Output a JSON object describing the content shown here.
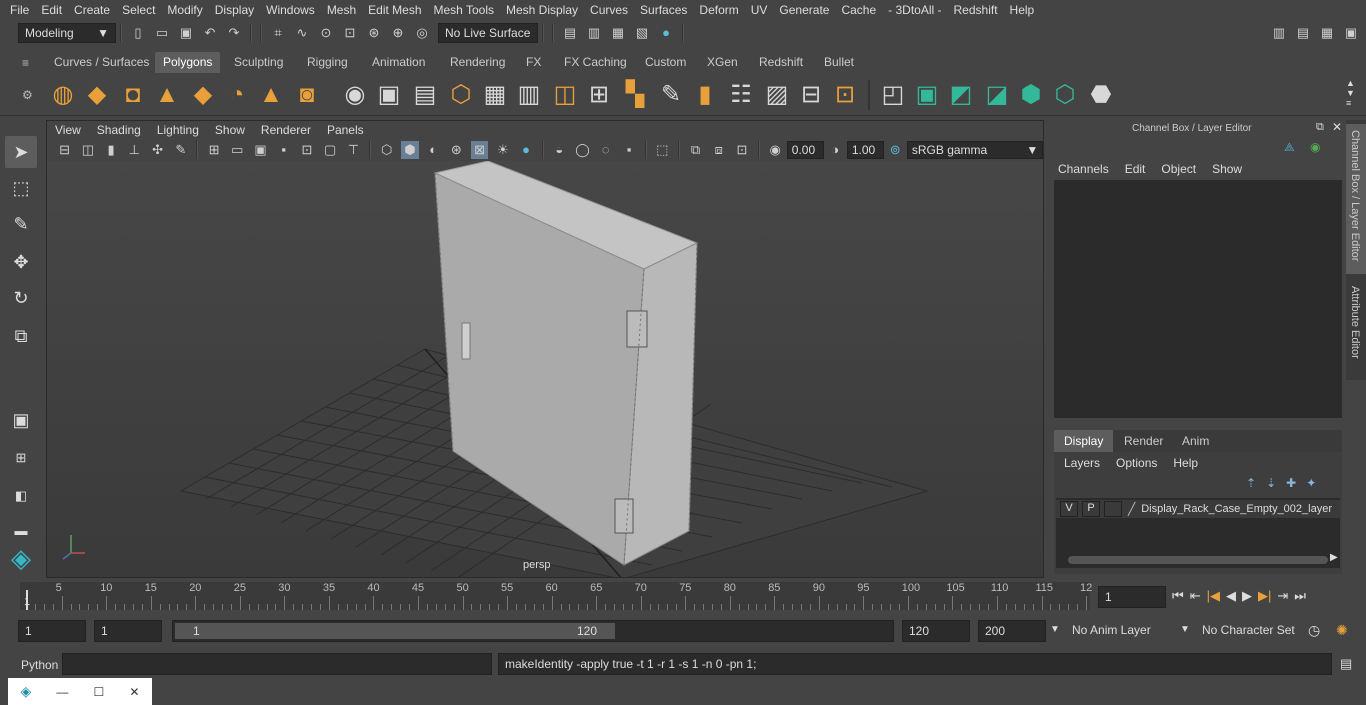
{
  "menubar": {
    "items": [
      "File",
      "Edit",
      "Create",
      "Select",
      "Modify",
      "Display",
      "Windows",
      "Mesh",
      "Edit Mesh",
      "Mesh Tools",
      "Mesh Display",
      "Curves",
      "Surfaces",
      "Deform",
      "UV",
      "Generate",
      "Cache",
      "- 3DtoAll -",
      "Redshift",
      "Help"
    ]
  },
  "statusline": {
    "mode": "Modeling",
    "live_surface": "No Live Surface"
  },
  "shelf": {
    "tabs": [
      "Curves / Surfaces",
      "Polygons",
      "Sculpting",
      "Rigging",
      "Animation",
      "Rendering",
      "FX",
      "FX Caching",
      "Custom",
      "XGen",
      "Redshift",
      "Bullet"
    ],
    "active_tab": "Polygons"
  },
  "viewport": {
    "menus": [
      "View",
      "Shading",
      "Lighting",
      "Show",
      "Renderer",
      "Panels"
    ],
    "exposure": "0.00",
    "gamma": "1.00",
    "color_space": "sRGB gamma",
    "camera_label": "persp"
  },
  "channelbox": {
    "title": "Channel Box / Layer Editor",
    "menus": [
      "Channels",
      "Edit",
      "Object",
      "Show"
    ]
  },
  "layereditor": {
    "tabs": [
      "Display",
      "Render",
      "Anim"
    ],
    "active_tab": "Display",
    "menus": [
      "Layers",
      "Options",
      "Help"
    ],
    "layer": {
      "v": "V",
      "p": "P",
      "name": "Display_Rack_Case_Empty_002_layer"
    }
  },
  "sidetabs": {
    "channel_box": "Channel Box / Layer Editor",
    "attribute_editor": "Attribute Editor"
  },
  "timeline": {
    "ticks": [
      "5",
      "10",
      "15",
      "20",
      "25",
      "30",
      "35",
      "40",
      "45",
      "50",
      "55",
      "60",
      "65",
      "70",
      "75",
      "80",
      "85",
      "90",
      "95",
      "100",
      "105",
      "110",
      "115",
      "12"
    ],
    "start_label": "1",
    "current_frame": "1"
  },
  "range": {
    "start": "1",
    "playback_start": "1",
    "slider_start": "1",
    "slider_end": "120",
    "end": "120",
    "max_end": "200",
    "anim_layer": "No Anim Layer",
    "character_set": "No Character Set"
  },
  "cmdline": {
    "label": "Python",
    "output": "makeIdentity -apply true -t 1 -r 1 -s 1 -n 0 -pn 1;"
  },
  "colors": {
    "accent_blue": "#5b9bd5",
    "shelf_orange": "#e8a03a",
    "shelf_green": "#34b89a",
    "active_tab": "#5d5d5d"
  }
}
